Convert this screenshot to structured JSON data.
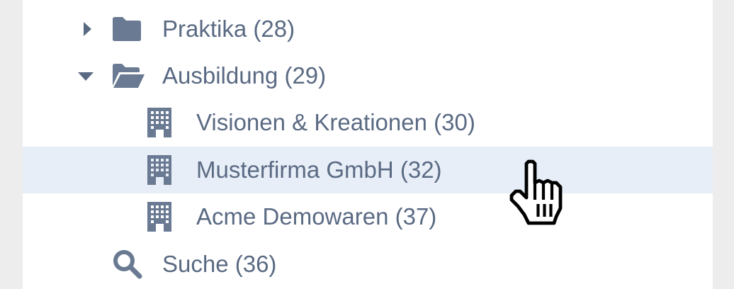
{
  "tree": {
    "items": [
      {
        "label": "Praktika (28)",
        "icon": "folder-icon",
        "expander": "caret-right-icon"
      },
      {
        "label": "Ausbildung (29)",
        "icon": "folder-open-icon",
        "expander": "caret-down-icon"
      },
      {
        "label": "Visionen & Kreationen (30)",
        "icon": "building-icon"
      },
      {
        "label": "Musterfirma GmbH (32)",
        "icon": "building-icon",
        "state": "hovered"
      },
      {
        "label": "Acme Demowaren (37)",
        "icon": "building-icon"
      },
      {
        "label": "Suche (36)",
        "icon": "search-icon"
      }
    ]
  },
  "colors": {
    "text": "#5a6a83",
    "icon": "#6a7a93",
    "hover_row": "#e7eef7",
    "panel": "#ffffff",
    "background": "#ededed"
  },
  "cursor": "hand-pointer-icon"
}
